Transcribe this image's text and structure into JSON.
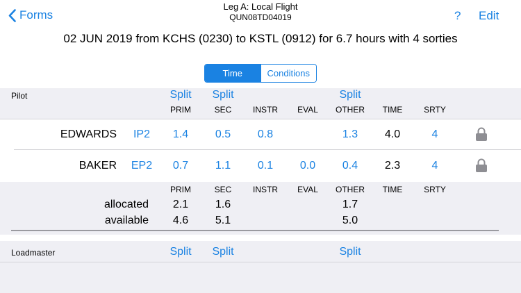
{
  "nav": {
    "back_label": "Forms",
    "title": "Leg A: Local Flight",
    "subtitle": "QUN08TD04019",
    "help_label": "?",
    "edit_label": "Edit"
  },
  "summary": "02 JUN 2019 from KCHS (0230) to KSTL (0912) for 6.7 hours with 4 sorties",
  "segments": [
    "Time",
    "Conditions"
  ],
  "pilot": {
    "section_label": "Pilot",
    "split_label": "Split",
    "columns": [
      "PRIM",
      "SEC",
      "INSTR",
      "EVAL",
      "OTHER",
      "TIME",
      "SRTY"
    ],
    "rows": [
      {
        "name": "EDWARDS",
        "code": "IP2",
        "prim": "1.4",
        "sec": "0.5",
        "instr": "0.8",
        "eval": "",
        "other": "1.3",
        "time": "4.0",
        "srty": "4"
      },
      {
        "name": "BAKER",
        "code": "EP2",
        "prim": "0.7",
        "sec": "1.1",
        "instr": "0.1",
        "eval": "0.0",
        "other": "0.4",
        "time": "2.3",
        "srty": "4"
      }
    ],
    "totals": {
      "columns": [
        "PRIM",
        "SEC",
        "INSTR",
        "EVAL",
        "OTHER",
        "TIME",
        "SRTY"
      ],
      "allocated_label": "allocated",
      "available_label": "available",
      "allocated": {
        "prim": "2.1",
        "sec": "1.6",
        "other": "1.7"
      },
      "available": {
        "prim": "4.6",
        "sec": "5.1",
        "other": "5.0"
      }
    }
  },
  "loadmaster": {
    "section_label": "Loadmaster",
    "split_label": "Split"
  },
  "colors": {
    "accent": "#1a82e2",
    "band": "#efeff4"
  },
  "icons": {
    "back": "chevron-left-icon",
    "lock": "lock-icon"
  }
}
